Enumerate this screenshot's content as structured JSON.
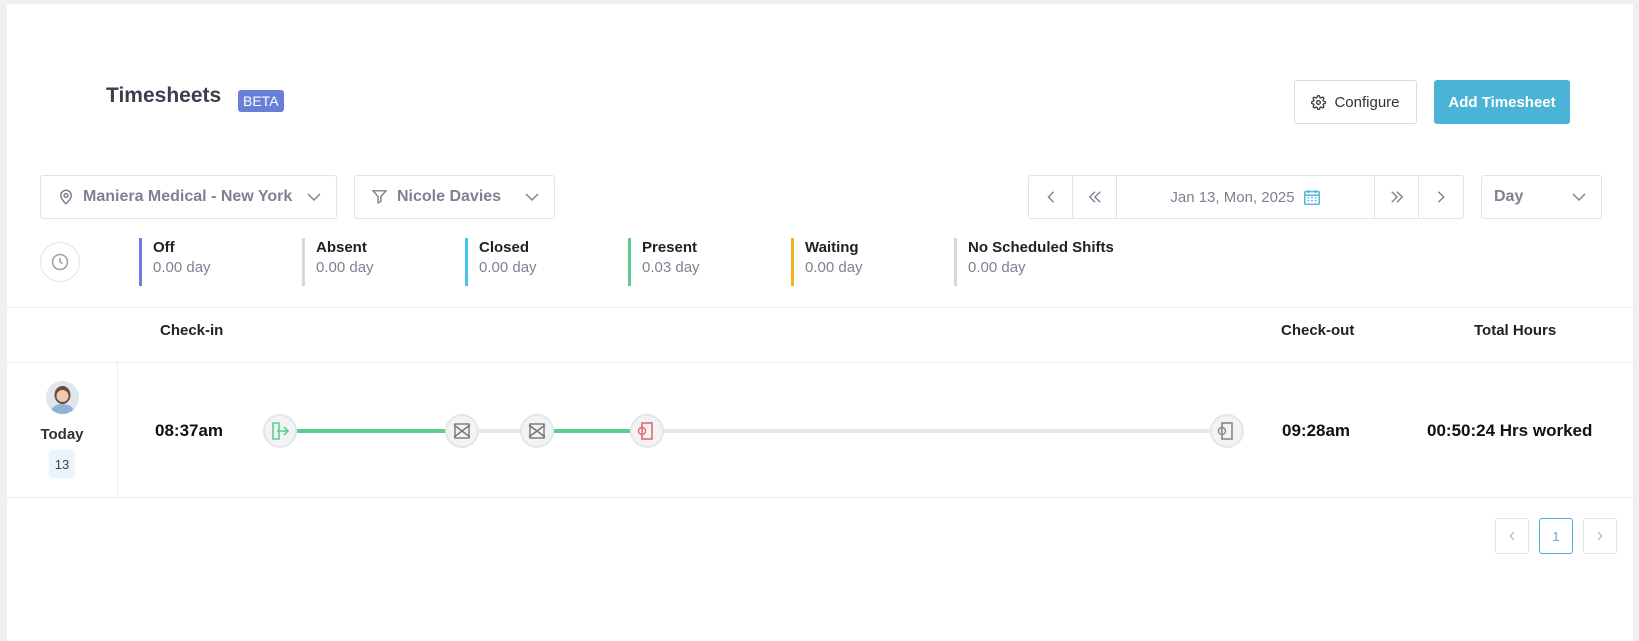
{
  "header": {
    "title": "Timesheets",
    "badge": "BETA",
    "configure_label": "Configure",
    "add_label": "Add Timesheet"
  },
  "filters": {
    "location": "Maniera Medical - New York",
    "person": "Nicole Davies",
    "date": "Jan 13, Mon, 2025",
    "range": "Day"
  },
  "summary": [
    {
      "label": "Off",
      "value": "0.00 day",
      "color": "#6a7fd8"
    },
    {
      "label": "Absent",
      "value": "0.00 day",
      "color": "#d5d8de"
    },
    {
      "label": "Closed",
      "value": "0.00 day",
      "color": "#4bc0e8"
    },
    {
      "label": "Present",
      "value": "0.03 day",
      "color": "#5bcf8f"
    },
    {
      "label": "Waiting",
      "value": "0.00 day",
      "color": "#f5b21c"
    },
    {
      "label": "No Scheduled Shifts",
      "value": "0.00 day",
      "color": "#d5d8de"
    }
  ],
  "table": {
    "headers": {
      "checkin": "Check-in",
      "checkout": "Check-out",
      "total": "Total Hours"
    },
    "rows": [
      {
        "day_label": "Today",
        "day_number": "13",
        "checkin": "08:37am",
        "checkout": "09:28am",
        "total": "00:50:24 Hrs worked",
        "events": [
          "check-in-icon",
          "break-start-icon",
          "break-end-icon",
          "check-out-icon",
          "scheduled-end-icon"
        ]
      }
    ]
  },
  "pagination": {
    "current": "1"
  },
  "colors": {
    "accent": "#4bb3d6",
    "badge": "#6a7fd8",
    "present": "#5bcf8f",
    "checkout_red": "#e46a6a"
  }
}
